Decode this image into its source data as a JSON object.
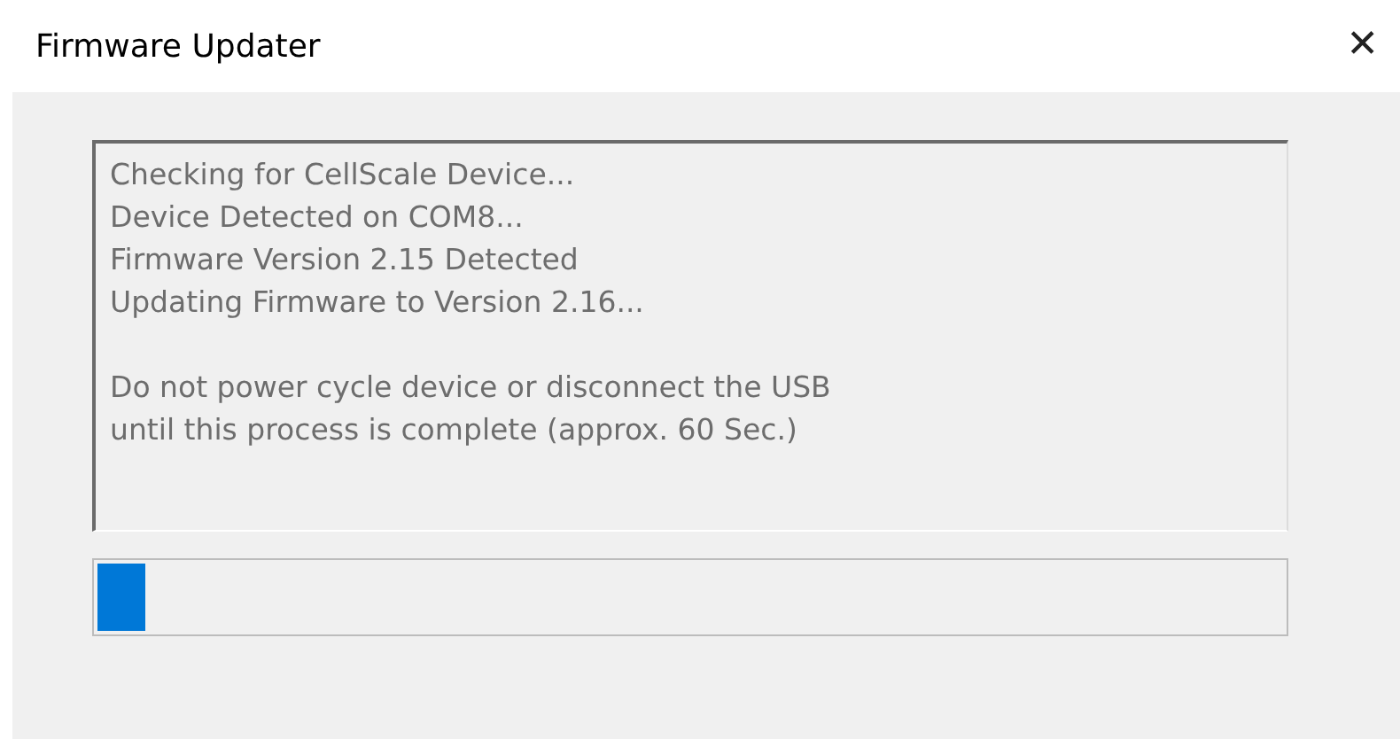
{
  "window": {
    "title": "Firmware Updater",
    "close": "✕"
  },
  "log": {
    "status_lines": [
      "Checking for CellScale Device...",
      "Device Detected on COM8...",
      "Firmware Version 2.15 Detected",
      "Updating Firmware to Version 2.16..."
    ],
    "warning_lines": [
      "Do not power cycle device or disconnect the USB",
      "until this process is complete (approx. 60 Sec.)"
    ]
  },
  "progress": {
    "level": 0.04
  }
}
